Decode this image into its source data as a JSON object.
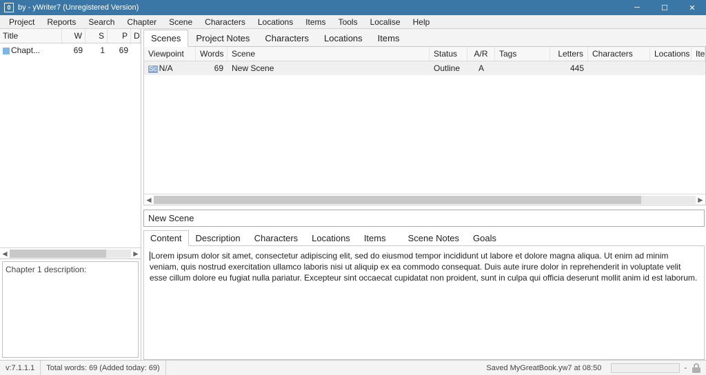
{
  "titlebar": {
    "text": "by  - yWriter7 (Unregistered Version)"
  },
  "menu": [
    "Project",
    "Reports",
    "Search",
    "Chapter",
    "Scene",
    "Characters",
    "Locations",
    "Items",
    "Tools",
    "Localise",
    "Help"
  ],
  "chapter_headers": {
    "title": "Title",
    "w": "W",
    "s": "S",
    "p": "P",
    "d": "D"
  },
  "chapter_row": {
    "title": "Chapt...",
    "w": "69",
    "s": "1",
    "p": "69"
  },
  "chapter_desc": "Chapter 1 description:",
  "top_tabs": [
    "Scenes",
    "Project Notes",
    "Characters",
    "Locations",
    "Items"
  ],
  "top_tab_active": 0,
  "scene_headers": {
    "viewpoint": "Viewpoint",
    "words": "Words",
    "scene": "Scene",
    "status": "Status",
    "ar": "A/R",
    "tags": "Tags",
    "letters": "Letters",
    "chars": "Characters",
    "locs": "Locations",
    "ite": "Ite"
  },
  "scene_row": {
    "sc": "Sc",
    "viewpoint": "N/A",
    "words": "69",
    "scene": "New Scene",
    "status": "Outline",
    "ar": "A",
    "tags": "",
    "letters": "445",
    "chars": "",
    "locs": "",
    "ite": ""
  },
  "scene_title": "New Scene",
  "content_tabs": [
    "Content",
    "Description",
    "Characters",
    "Locations",
    "Items",
    "Scene Notes",
    "Goals"
  ],
  "content_tab_active": 0,
  "content_text": "Lorem ipsum dolor sit amet, consectetur adipiscing elit, sed do eiusmod tempor incididunt ut labore et dolore magna aliqua. Ut enim ad minim veniam, quis nostrud exercitation ullamco laboris nisi ut aliquip ex ea commodo consequat. Duis aute irure dolor in reprehenderit in voluptate velit esse cillum dolore eu fugiat nulla pariatur. Excepteur sint occaecat cupidatat non proident, sunt in culpa qui officia deserunt mollit anim id est laborum.",
  "status": {
    "version": "v:7.1.1.1",
    "words": "Total words: 69 (Added today: 69)",
    "saved": "Saved MyGreatBook.yw7 at 08:50",
    "dash": "-"
  }
}
